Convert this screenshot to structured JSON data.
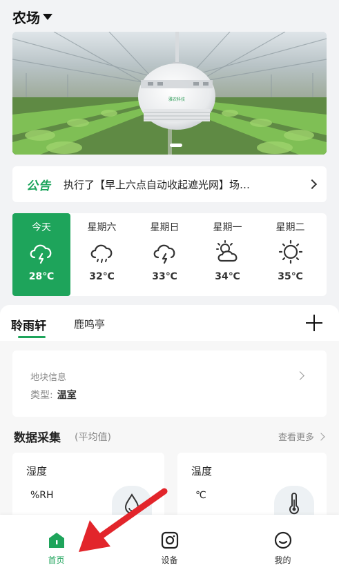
{
  "header": {
    "title": "农场"
  },
  "banner": {
    "device_label": "雅农科技"
  },
  "notice": {
    "tag": "公告",
    "text": "执行了【早上六点自动收起遮光网】场…"
  },
  "weather": {
    "days": [
      {
        "label": "今天",
        "temp": "28℃",
        "icon": "thunder-rain-icon"
      },
      {
        "label": "星期六",
        "temp": "32℃",
        "icon": "rain-cloud-icon"
      },
      {
        "label": "星期日",
        "temp": "33℃",
        "icon": "thunder-rain-icon"
      },
      {
        "label": "星期一",
        "temp": "34℃",
        "icon": "partly-cloudy-icon"
      },
      {
        "label": "星期二",
        "temp": "35℃",
        "icon": "sunny-icon"
      }
    ]
  },
  "tabs": [
    {
      "label": "聆雨轩"
    },
    {
      "label": "鹿鸣亭"
    }
  ],
  "plot": {
    "title": "地块信息",
    "type_label": "类型:",
    "type_value": "温室"
  },
  "section": {
    "title": "数据采集",
    "subtitle": "(平均值)",
    "more": "查看更多"
  },
  "metrics": [
    {
      "name": "湿度",
      "unit": "%RH",
      "icon": "droplet-icon"
    },
    {
      "name": "温度",
      "unit": "℃",
      "icon": "thermometer-icon"
    }
  ],
  "nav": [
    {
      "label": "首页",
      "icon": "home-icon"
    },
    {
      "label": "设备",
      "icon": "device-icon"
    },
    {
      "label": "我的",
      "icon": "profile-icon"
    }
  ],
  "colors": {
    "accent": "#1ea45b",
    "annotation_arrow": "#e2252b"
  }
}
